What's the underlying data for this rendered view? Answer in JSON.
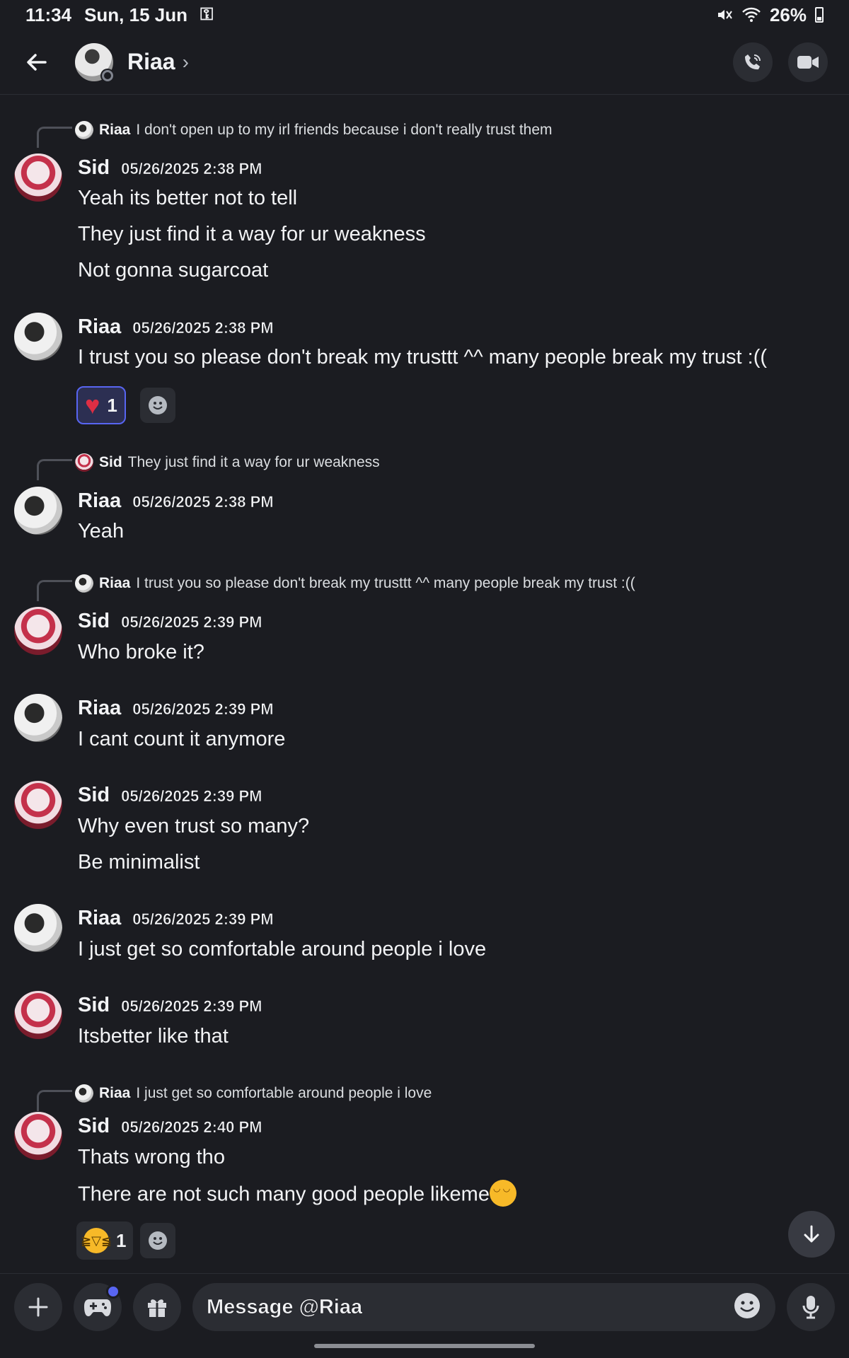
{
  "status_bar": {
    "time": "11:34",
    "date": "Sun, 15 Jun",
    "battery": "26%",
    "icons": [
      "key-icon",
      "mute-icon",
      "wifi-icon",
      "battery-icon"
    ]
  },
  "header": {
    "contact_name": "Riaa",
    "icons": [
      "back-arrow-icon",
      "chevron-right-icon",
      "voice-call-icon",
      "video-call-icon"
    ]
  },
  "messages": [
    {
      "reply_author": "Riaa",
      "reply_text": "I don't open up to my irl friends because i don't really trust them",
      "author": "Sid",
      "timestamp": "05/26/2025 2:38 PM",
      "lines": [
        "Yeah its better not to tell",
        "They just find it a way for ur weakness",
        "Not gonna sugarcoat"
      ]
    },
    {
      "author": "Riaa",
      "timestamp": "05/26/2025 2:38 PM",
      "lines": [
        "I trust you so please don't break my trusttt ^^ many people break my trust :(("
      ],
      "reaction": {
        "emoji": "heart-icon",
        "count": "1"
      }
    },
    {
      "reply_author": "Sid",
      "reply_text": "They just find it a way for ur weakness",
      "author": "Riaa",
      "timestamp": "05/26/2025 2:38 PM",
      "lines": [
        "Yeah"
      ]
    },
    {
      "reply_author": "Riaa",
      "reply_text": "I trust you so please don't break my trusttt ^^ many people break my trust :((",
      "author": "Sid",
      "timestamp": "05/26/2025 2:39 PM",
      "lines": [
        "Who broke it?"
      ]
    },
    {
      "author": "Riaa",
      "timestamp": "05/26/2025 2:39 PM",
      "lines": [
        "I cant count it anymore"
      ]
    },
    {
      "author": "Sid",
      "timestamp": "05/26/2025 2:39 PM",
      "lines": [
        "Why even trust so many?",
        "Be minimalist"
      ]
    },
    {
      "author": "Riaa",
      "timestamp": "05/26/2025 2:39 PM",
      "lines": [
        "I just get so comfortable around people i love"
      ]
    },
    {
      "author": "Sid",
      "timestamp": "05/26/2025 2:39 PM",
      "lines": [
        "Itsbetter like that"
      ]
    },
    {
      "reply_author": "Riaa",
      "reply_text": "I just get so comfortable around people i love",
      "author": "Sid",
      "timestamp": "05/26/2025 2:40 PM",
      "lines": [
        "Thats wrong tho",
        "There are not such many good people likeme"
      ],
      "reaction": {
        "emoji": "laughing-face-icon",
        "count": "1"
      }
    }
  ],
  "composer": {
    "placeholder": "Message @Riaa",
    "icons": [
      "plus-icon",
      "gamepad-icon",
      "gift-icon",
      "emoji-icon",
      "microphone-icon"
    ]
  },
  "colors": {
    "background": "#1b1c21",
    "surface": "#2b2d33",
    "accent": "#5865f2",
    "heart": "#dd2e44"
  }
}
